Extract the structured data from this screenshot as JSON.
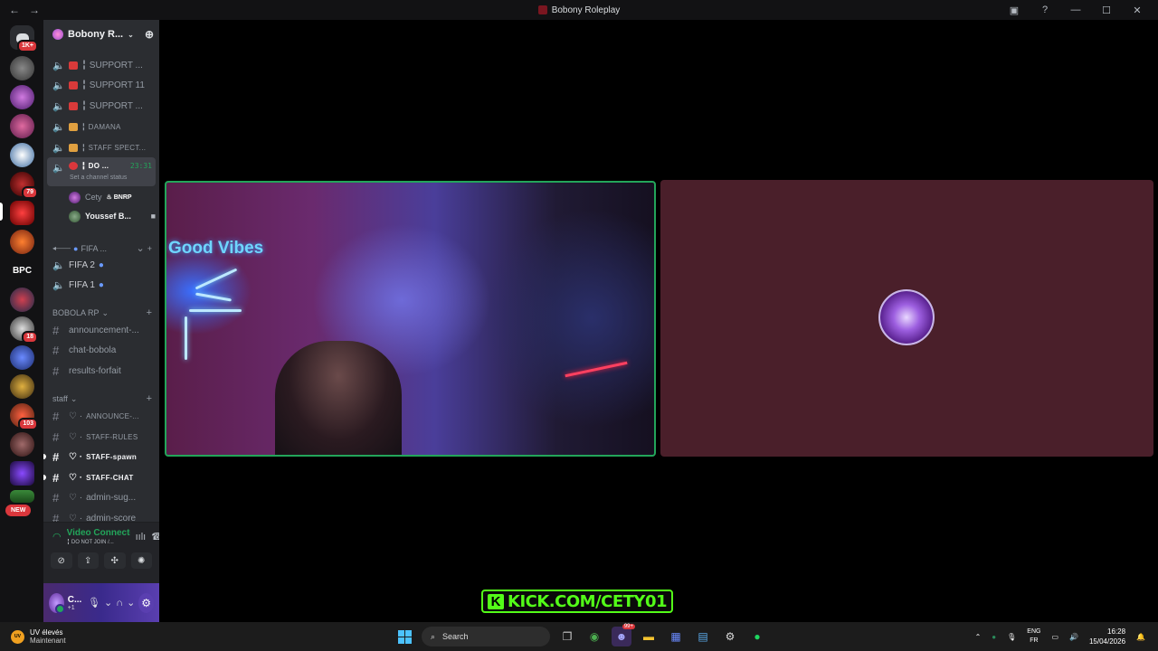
{
  "window": {
    "title": "Bobony Roleplay",
    "back": "←",
    "forward": "→",
    "help": "?",
    "minimize": "—",
    "maximize": "☐",
    "close": "✕"
  },
  "guilds": {
    "dm_badge": "1K+",
    "badges": [
      "79",
      "18",
      "103"
    ],
    "bpc_label": "BPC",
    "new_label": "NEW"
  },
  "server": {
    "name": "Bobony R...",
    "invite_icon": "add-user-icon"
  },
  "voice_channels": [
    {
      "label": "╏ SUPPORT ...",
      "emoji": "SOS"
    },
    {
      "label": "╏ SUPPORT 11",
      "emoji": "SOS"
    },
    {
      "label": "╏ SUPPORT ...",
      "emoji": "SOS"
    },
    {
      "label": "╏ DAMANA",
      "emoji": "gift"
    },
    {
      "label": "╏ STAFF SPECT...",
      "emoji": "gift"
    }
  ],
  "active_channel": {
    "label": "╏ DO ...",
    "timer": "23:31",
    "status_prompt": "Set a channel status"
  },
  "connected_users": [
    {
      "name": "Cety",
      "tag": "BNRP"
    },
    {
      "name": "Youssef B..."
    }
  ],
  "fifa": {
    "category": "FIFA ...",
    "channels": [
      "FIFA 2",
      "FIFA 1"
    ]
  },
  "bobola": {
    "category": "BOBOLA RP",
    "channels": [
      "announcement-...",
      "chat-bobola",
      "results-forfait"
    ]
  },
  "staff": {
    "category": "staff",
    "channels": [
      "ANNOUNCE-...",
      "STAFF-RULES",
      "STAFF-spawn",
      "STAFF-CHAT",
      "admin-sug...",
      "admin-score"
    ]
  },
  "voice_panel": {
    "status": "Video Connected",
    "channel": "╏ DO NOT JOIN /..."
  },
  "user_panel": {
    "name": "C...",
    "status": "+1"
  },
  "stream_banner": {
    "k": "K",
    "text": "KICK.COM/CETY01"
  },
  "cam_tile": {
    "neon": "Good Vibes"
  },
  "taskbar": {
    "weather_title": "UV élevés",
    "weather_sub": "Maintenant",
    "search_placeholder": "Search",
    "lang_top": "ENG",
    "lang_bottom": "FR",
    "time": "16:28",
    "date": "15/04/2026",
    "discord_badge": "99+"
  }
}
